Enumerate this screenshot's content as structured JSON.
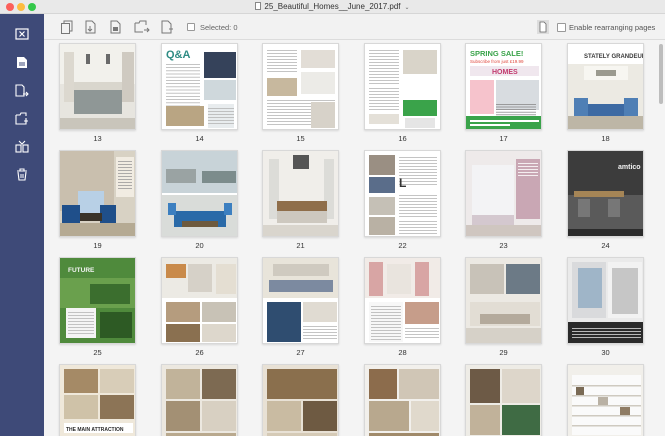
{
  "window": {
    "title": "25_Beautiful_Homes__June_2017.pdf"
  },
  "toolbar": {
    "selected_label": "Selected: 0",
    "rearrange_label": "Enable rearranging pages"
  },
  "sidebar": {
    "items": [
      {
        "icon": "close-document-icon"
      },
      {
        "icon": "extract-page-icon"
      },
      {
        "icon": "insert-page-icon"
      },
      {
        "icon": "replace-page-icon"
      },
      {
        "icon": "split-page-icon"
      },
      {
        "icon": "trash-icon"
      }
    ]
  },
  "pages": [
    {
      "number": "13",
      "style": "kitchen"
    },
    {
      "number": "14",
      "style": "qa"
    },
    {
      "number": "15",
      "style": "text-photo"
    },
    {
      "number": "16",
      "style": "text-green"
    },
    {
      "number": "17",
      "style": "sale",
      "cover": "SPRING SALE!",
      "tagline": "Subscribe from just £19.99",
      "brand": "HOMES"
    },
    {
      "number": "18",
      "style": "grandeur",
      "headline": "STATELY GRANDEUR"
    },
    {
      "number": "19",
      "style": "livingroom"
    },
    {
      "number": "20",
      "style": "conservatory"
    },
    {
      "number": "21",
      "style": "dining"
    },
    {
      "number": "22",
      "style": "textphotos"
    },
    {
      "number": "23",
      "style": "pink"
    },
    {
      "number": "24",
      "style": "amtico",
      "brand": "amtico"
    },
    {
      "number": "25",
      "style": "garden",
      "headline": "FUTURE"
    },
    {
      "number": "26",
      "style": "interiors"
    },
    {
      "number": "27",
      "style": "kitchen2"
    },
    {
      "number": "28",
      "style": "curtains"
    },
    {
      "number": "29",
      "style": "bedroom"
    },
    {
      "number": "30",
      "style": "stairs"
    },
    {
      "number": "",
      "style": "collage-a",
      "headline": "THE MAIN ATTRACTION"
    },
    {
      "number": "",
      "style": "collage-b"
    },
    {
      "number": "",
      "style": "collage-c"
    },
    {
      "number": "",
      "style": "collage-d"
    },
    {
      "number": "",
      "style": "collage-e"
    },
    {
      "number": "",
      "style": "shelves"
    }
  ]
}
